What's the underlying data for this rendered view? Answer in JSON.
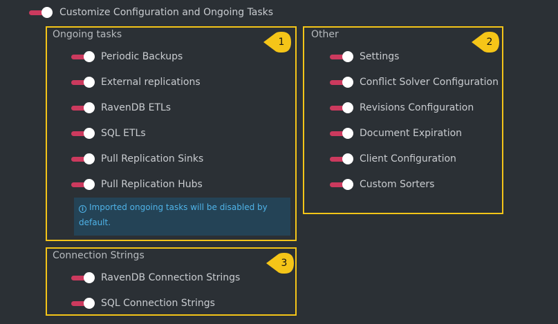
{
  "header": {
    "label": "Customize Configuration and Ongoing Tasks"
  },
  "ongoing": {
    "title": "Ongoing tasks",
    "callout": "1",
    "items": [
      "Periodic Backups",
      "External replications",
      "RavenDB ETLs",
      "SQL ETLs",
      "Pull Replication Sinks",
      "Pull Replication Hubs"
    ],
    "notice": "Imported ongoing tasks will be disabled by default.",
    "notice_icon": "info-icon"
  },
  "other": {
    "title": "Other",
    "callout": "2",
    "items": [
      "Settings",
      "Conflict Solver Configuration",
      "Revisions Configuration",
      "Document Expiration",
      "Client Configuration",
      "Custom Sorters"
    ]
  },
  "connection": {
    "title": "Connection Strings",
    "callout": "3",
    "items": [
      "RavenDB Connection Strings",
      "SQL Connection Strings"
    ]
  },
  "colors": {
    "background": "#2b3035",
    "toggle_on": "#cc3a5e",
    "highlight_box": "#f5c518",
    "notice_bg": "#244356",
    "notice_text": "#4fb3e8"
  }
}
